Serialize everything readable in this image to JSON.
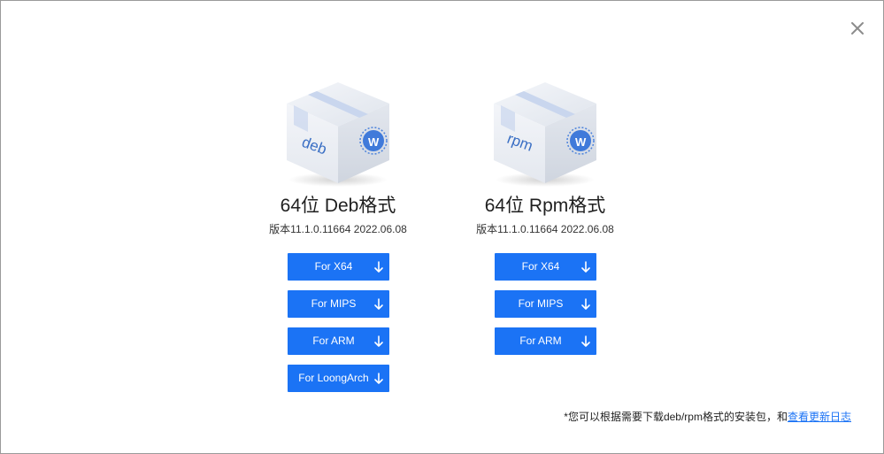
{
  "dialog": {
    "close_icon": "close-icon"
  },
  "packages": {
    "deb": {
      "box_label": "deb",
      "title": "64位 Deb格式",
      "version": "版本11.1.0.11664 2022.06.08",
      "buttons": [
        "For X64",
        "For MIPS",
        "For ARM",
        "For LoongArch"
      ]
    },
    "rpm": {
      "box_label": "rpm",
      "title": "64位 Rpm格式",
      "version": "版本11.1.0.11664 2022.06.08",
      "buttons": [
        "For X64",
        "For MIPS",
        "For ARM"
      ]
    }
  },
  "footer": {
    "note": "*您可以根据需要下载deb/rpm格式的安装包，和",
    "link": "查看更新日志"
  },
  "colors": {
    "accent": "#1b73f5",
    "text": "#1f1f1f"
  }
}
